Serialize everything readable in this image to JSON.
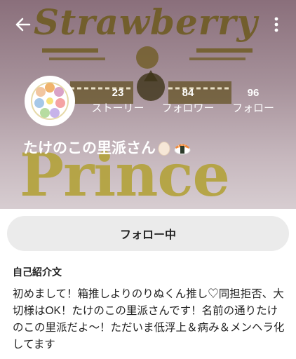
{
  "header": {
    "background_text_top": "Strawberry",
    "background_text_bottom": "Prince",
    "back_icon": "arrow-left-icon",
    "more_icon": "more-vertical-icon"
  },
  "profile": {
    "username": "たけのこの里派さん",
    "emojis": [
      "egg-icon",
      "sushi-icon"
    ],
    "stats": {
      "stories": {
        "count": "23",
        "label": "ストーリー"
      },
      "followers": {
        "count": "84",
        "label": "フォロワー"
      },
      "following": {
        "count": "96",
        "label": "フォロー"
      }
    }
  },
  "follow_button": {
    "label": "フォロー中"
  },
  "bio": {
    "title": "自己紹介文",
    "text": "初めまして！箱推しよりのりぬくん推し♡同担拒否、大切様はOK！たけのこの里派さんです！名前の通りたけのこの里派だよ～！ただいま低浮上＆病み＆メンヘラ化してます"
  },
  "colors": {
    "header_top": "#8a6f7b",
    "header_bottom": "#d7cdd1",
    "button_bg": "#ebebeb",
    "text": "#222222"
  }
}
